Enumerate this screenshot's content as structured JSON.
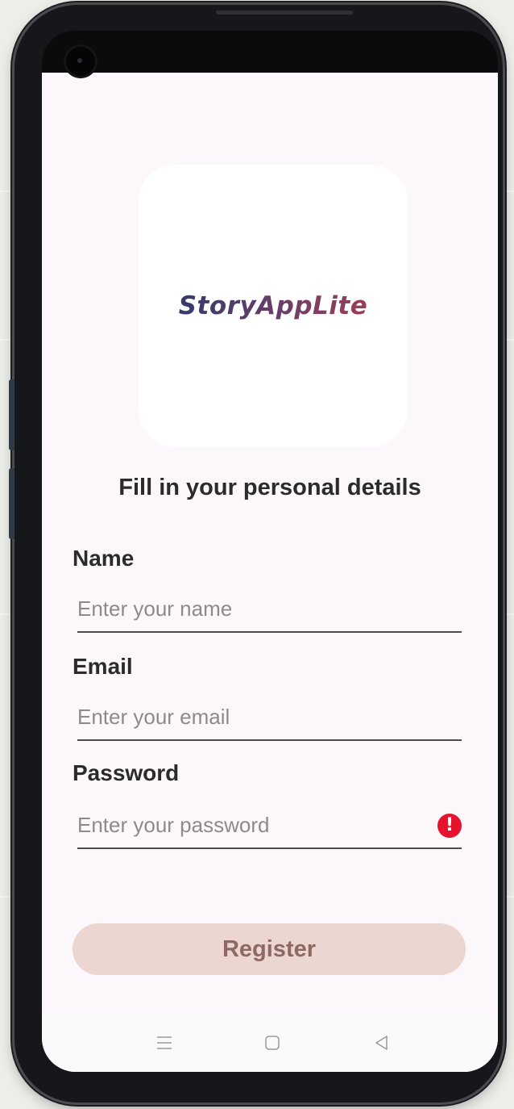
{
  "app": {
    "logo_text": "StoryAppLite"
  },
  "form": {
    "heading": "Fill in your personal details",
    "name": {
      "label": "Name",
      "placeholder": "Enter your name",
      "value": ""
    },
    "email": {
      "label": "Email",
      "placeholder": "Enter your email",
      "value": ""
    },
    "password": {
      "label": "Password",
      "placeholder": "Enter your password",
      "value": "",
      "error_icon": "!"
    },
    "register_label": "Register"
  },
  "nav": {
    "items": [
      "menu-icon",
      "home-icon",
      "back-icon"
    ]
  },
  "colors": {
    "screen_bg": "#fcf7fb",
    "button_bg": "#ecd6d1",
    "button_text": "#8c6a62",
    "error": "#e5132d",
    "logo_start": "#343b6a",
    "logo_end": "#9a3f55"
  }
}
